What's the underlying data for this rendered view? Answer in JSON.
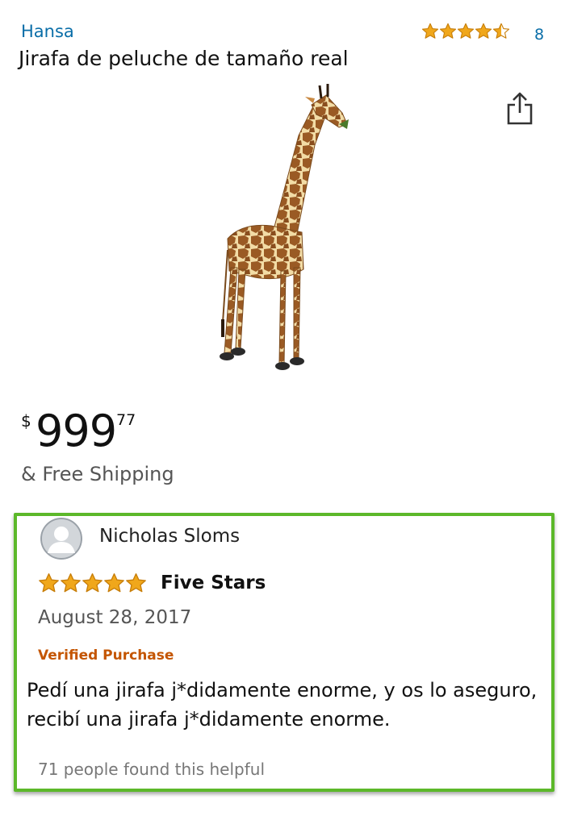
{
  "product": {
    "brand": "Hansa",
    "title": "Jirafa de peluche de tamaño real",
    "rating_count": "8",
    "rating_stars": 4.5,
    "price_symbol": "$",
    "price_whole": "999",
    "price_cents": "77",
    "shipping": "& Free Shipping",
    "image_icon": "giraffe-plush-image"
  },
  "review": {
    "reviewer": "Nicholas Sloms",
    "stars": 5,
    "title": "Five Stars",
    "date": "August 28, 2017",
    "verified": "Verified Purchase",
    "body": "Pedí una jirafa j*didamente enorme, y os lo aseguro, recibí una jirafa j*didamente enorme.",
    "helpful": "71 people found this helpful"
  },
  "colors": {
    "link": "#0a6ea8",
    "star": "#f0a71b",
    "verified": "#c45500",
    "highlight_border": "#5cb82a"
  }
}
